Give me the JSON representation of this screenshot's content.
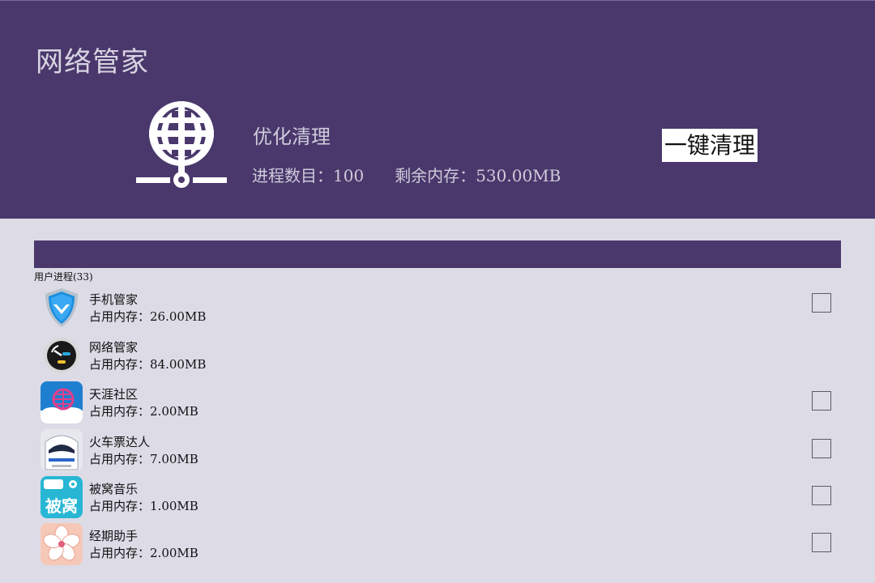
{
  "header": {
    "title": "网络管家",
    "section_title": "优化清理",
    "process_count_label": "进程数目：",
    "process_count": "100",
    "free_memory_label": "剩余内存：",
    "free_memory": "530.00MB",
    "clean_button": "一键清理",
    "globe_icon": "globe-network-icon"
  },
  "list": {
    "group_label": "用户进程(33)",
    "items": [
      {
        "name": "手机管家",
        "mem_label": "占用内存：",
        "mem": "26.00MB",
        "icon": "shield-icon",
        "checkbox": true
      },
      {
        "name": "网络管家",
        "mem_label": "占用内存：",
        "mem": "84.00MB",
        "icon": "speedometer-icon",
        "checkbox": false
      },
      {
        "name": "天涯社区",
        "mem_label": "占用内存：",
        "mem": "2.00MB",
        "icon": "tianya-icon",
        "checkbox": true
      },
      {
        "name": "火车票达人",
        "mem_label": "占用内存：",
        "mem": "7.00MB",
        "icon": "train-icon",
        "checkbox": true
      },
      {
        "name": "被窝音乐",
        "mem_label": "占用内存：",
        "mem": "1.00MB",
        "icon": "beiwo-music-icon",
        "icon_text": "被窝",
        "checkbox": true
      },
      {
        "name": "经期助手",
        "mem_label": "占用内存：",
        "mem": "2.00MB",
        "icon": "flower-icon",
        "checkbox": true
      }
    ]
  },
  "colors": {
    "header_bg": "#4a386c",
    "page_bg": "#dcdbe6"
  }
}
